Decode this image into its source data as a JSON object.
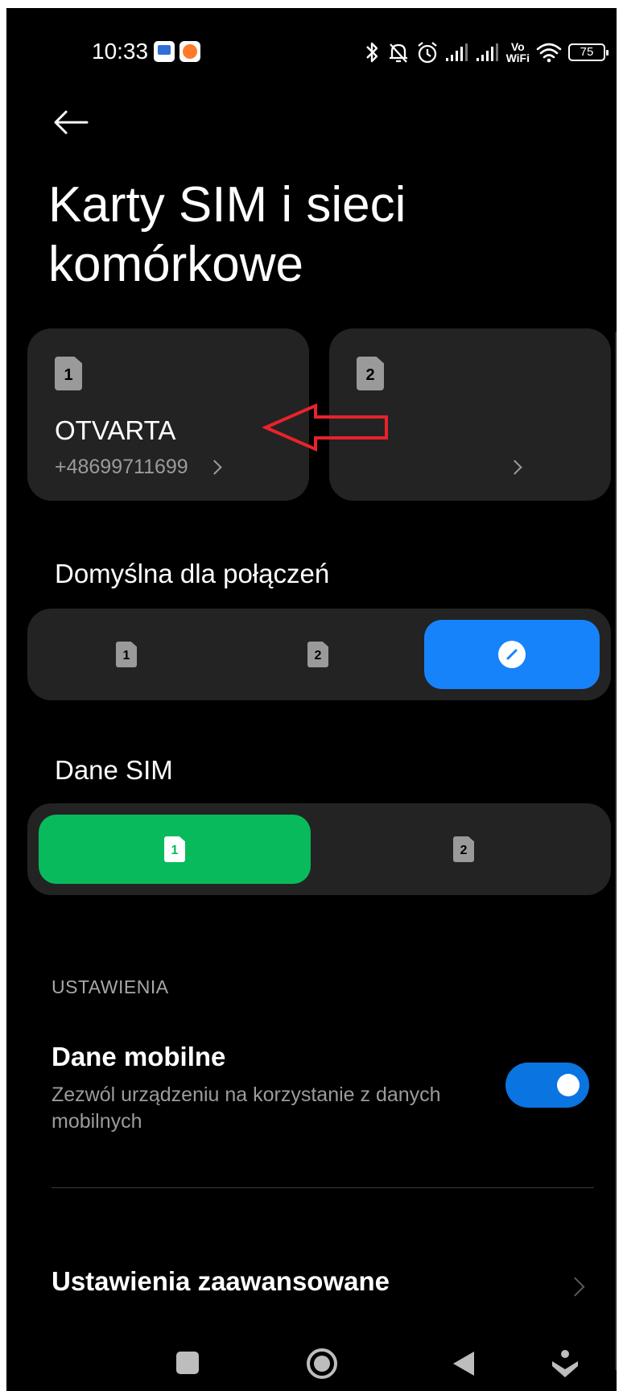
{
  "status_bar": {
    "time": "10:33",
    "icons": [
      "bluetooth-icon",
      "bell-off-icon",
      "alarm-icon",
      "signal-1-icon",
      "signal-2-icon",
      "vowifi-icon",
      "wifi-icon",
      "battery-icon"
    ],
    "vowifi_line1": "Vo",
    "vowifi_line2": "WiFi",
    "battery_level": "75"
  },
  "header": {
    "title": "Karty SIM i sieci komórkowe"
  },
  "sim_cards": [
    {
      "slot": "1",
      "name": "OTVARTA",
      "number": "+48699711699"
    },
    {
      "slot": "2",
      "name": "",
      "number": ""
    }
  ],
  "calls_default": {
    "label": "Domyślna dla połączeń",
    "options": [
      {
        "slot": "1",
        "selected": false
      },
      {
        "slot": "2",
        "selected": false
      },
      {
        "icon": "ask-every-time-icon",
        "selected": true
      }
    ],
    "active_color": "#1783fb"
  },
  "sim_data": {
    "label": "Dane SIM",
    "options": [
      {
        "slot": "1",
        "selected": true
      },
      {
        "slot": "2",
        "selected": false
      }
    ],
    "active_color": "#08ba5c"
  },
  "settings": {
    "section_header": "USTAWIENIA",
    "mobile_data": {
      "title": "Dane mobilne",
      "description": "Zezwól urządzeniu na korzystanie z danych mobilnych",
      "enabled": true
    },
    "advanced_label": "Ustawienia zaawansowane"
  },
  "colors": {
    "background": "#000000",
    "card": "#232323",
    "annotation_arrow": "#e8222c",
    "toggle_on": "#0a74e0"
  }
}
